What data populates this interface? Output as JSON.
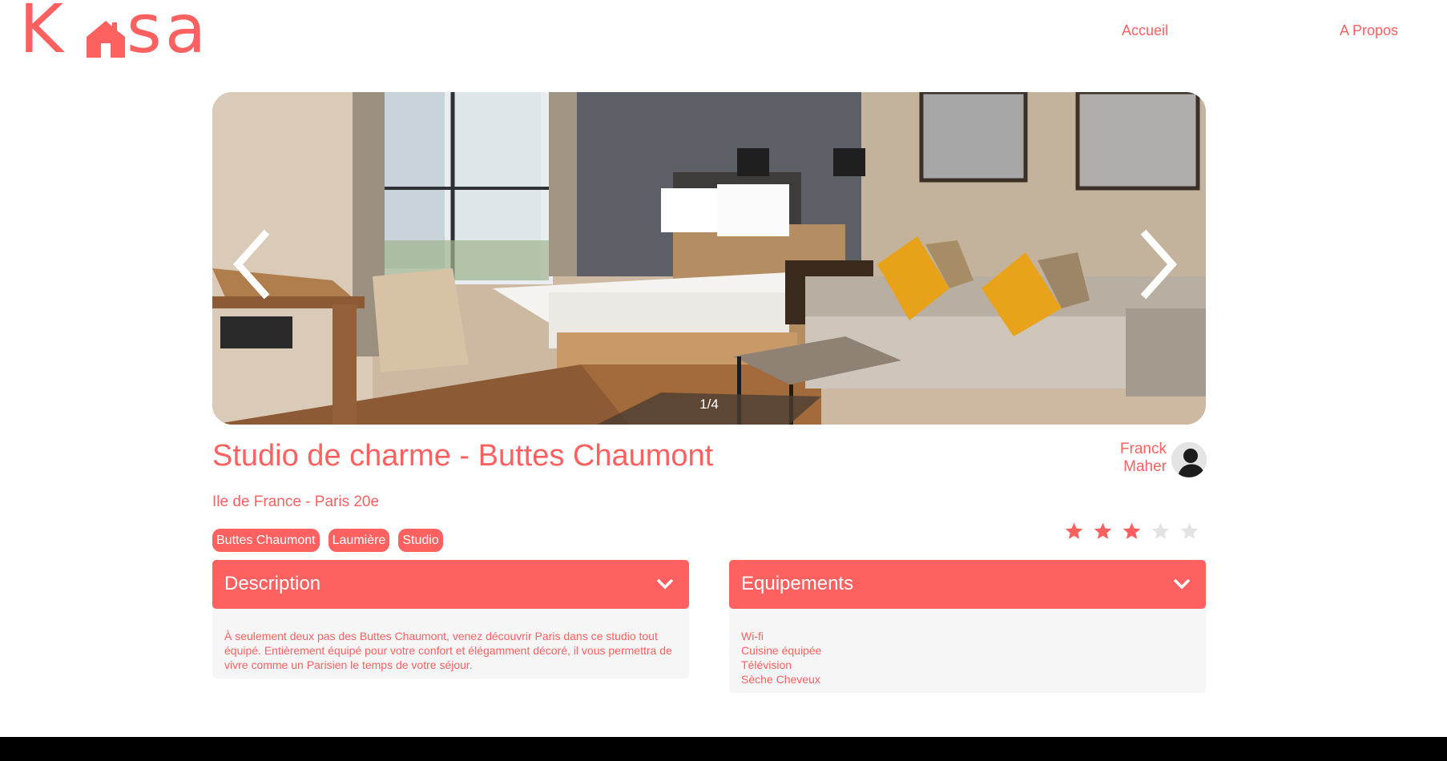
{
  "brand": {
    "logo_text": "Kasa",
    "logo_icon": "house-icon"
  },
  "nav": {
    "home_label": "Accueil",
    "about_label": "A Propos"
  },
  "carousel": {
    "counter": "1/4",
    "prev_icon": "chevron-left-icon",
    "next_icon": "chevron-right-icon"
  },
  "listing": {
    "title": "Studio de charme - Buttes Chaumont",
    "location": "Ile de France - Paris 20e",
    "tags": [
      "Buttes Chaumont",
      "Laumière",
      "Studio"
    ],
    "rating": 3,
    "rating_max": 5
  },
  "host": {
    "first_name": "Franck",
    "last_name": "Maher"
  },
  "description": {
    "title": "Description",
    "text": "À seulement deux pas des Buttes Chaumont, venez découvrir Paris dans ce studio tout équipé. Entièrement équipé pour votre confort et élégamment décoré, il vous permettra de vivre comme un Parisien le temps de votre séjour."
  },
  "equipments": {
    "title": "Equipements",
    "items": [
      "Wi-fi",
      "Cuisine équipée",
      "Télévision",
      "Sèche Cheveux"
    ]
  },
  "colors": {
    "accent": "#FF6060",
    "star_off": "#E3E3E3",
    "panel_bg": "#F6F6F6",
    "footer": "#000000"
  }
}
